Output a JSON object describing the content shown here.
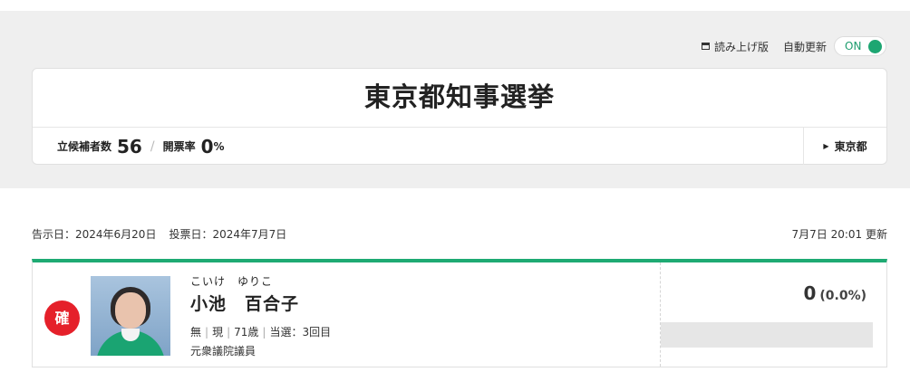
{
  "utility": {
    "read_aloud_label": "読み上げ版",
    "auto_update_label": "自動更新",
    "auto_update_state": "ON"
  },
  "election": {
    "title": "東京都知事選挙",
    "candidates_label": "立候補者数",
    "candidates_count": "56",
    "counting_label": "開票率",
    "counting_value": "0",
    "counting_unit": "%",
    "prefecture_link": "東京都"
  },
  "dates": {
    "announce": "告示日：2024年6月20日",
    "vote": "投票日：2024年7月7日",
    "updated": "7月7日 20:01 更新"
  },
  "candidate": {
    "badge": "確",
    "kana": "こいけ　ゆりこ",
    "name": "小池　百合子",
    "party": "無",
    "status": "現",
    "age": "71歳",
    "elected_times": "当選：3回目",
    "career": "元衆議院議員",
    "votes": "0",
    "vote_pct": "(0.0%)",
    "vote_share": 0
  },
  "colors": {
    "accent": "#1eaa73",
    "badge": "#e5202a",
    "band": "#efefef"
  }
}
